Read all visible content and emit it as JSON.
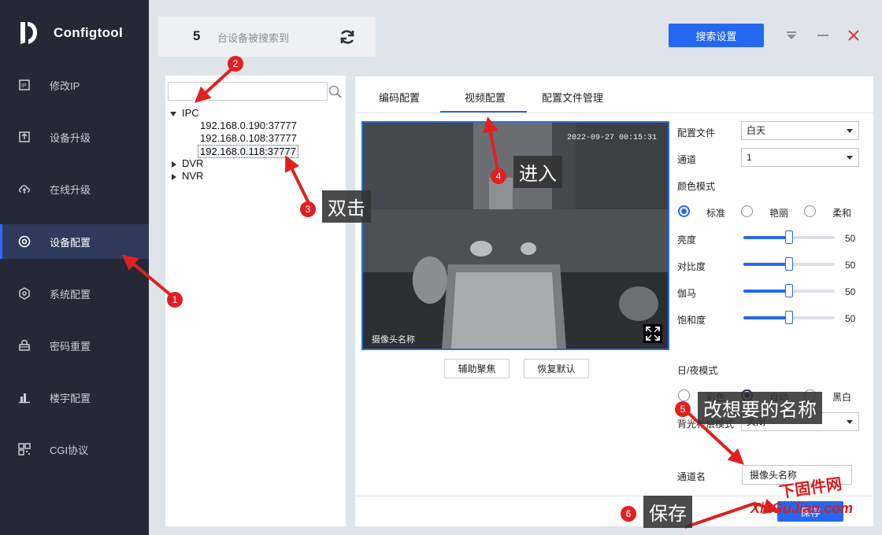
{
  "app": {
    "title": "Configtool"
  },
  "sidebar": {
    "items": [
      {
        "label": "修改IP",
        "icon": "ip-icon"
      },
      {
        "label": "设备升级",
        "icon": "upload-icon"
      },
      {
        "label": "在线升级",
        "icon": "cloud-upload-icon"
      },
      {
        "label": "设备配置",
        "icon": "target-icon",
        "active": true
      },
      {
        "label": "系统配置",
        "icon": "hexagon-gear-icon"
      },
      {
        "label": "密码重置",
        "icon": "lock-icon"
      },
      {
        "label": "楼宇配置",
        "icon": "bar-chart-icon"
      },
      {
        "label": "CGI协议",
        "icon": "qr-code-icon"
      }
    ]
  },
  "header": {
    "device_count": "5",
    "device_count_label": "台设备被搜索到",
    "search_settings_label": "搜索设置"
  },
  "tree": {
    "search_placeholder": "",
    "groups": [
      {
        "label": "IPC",
        "expanded": true,
        "children": [
          "192.168.0.190:37777",
          "192.168.0.108:37777",
          "192.168.0.118:37777"
        ]
      },
      {
        "label": "DVR",
        "expanded": false
      },
      {
        "label": "NVR",
        "expanded": false
      }
    ]
  },
  "config": {
    "tabs": [
      "编码配置",
      "视频配置",
      "配置文件管理"
    ],
    "active_tab": "视频配置",
    "video": {
      "timestamp": "2022-09-27 00:15:31",
      "camera_name": "摄像头名称"
    },
    "assist_focus_label": "辅助聚焦",
    "restore_default_label": "恢复默认",
    "profile_label": "配置文件",
    "profile_value": "白天",
    "channel_label": "通道",
    "channel_value": "1",
    "color_mode_label": "颜色模式",
    "color_modes": [
      "标准",
      "艳丽",
      "柔和"
    ],
    "color_mode_selected": "标准",
    "brightness_label": "亮度",
    "brightness_value": "50",
    "contrast_label": "对比度",
    "contrast_value": "50",
    "gamma_label": "伽马",
    "gamma_value": "50",
    "saturation_label": "饱和度",
    "saturation_value": "50",
    "daynight_label": "日/夜模式",
    "daynight_modes": [
      "彩色",
      "自动",
      "黑白"
    ],
    "daynight_selected": "自动",
    "backlight_label": "背光补偿模式",
    "backlight_value": "关闭",
    "channel_name_label": "通道名",
    "channel_name_value": "摄像头名称",
    "save_label": "保存"
  },
  "annotations": {
    "n1": "1",
    "n2": "2",
    "n3": "3",
    "n4": "4",
    "n5": "5",
    "n6": "6",
    "double_click": "双击",
    "enter": "进入",
    "rename": "改想要的名称",
    "save": "保存"
  },
  "watermark": {
    "top": "下固件网",
    "bottom": "XiaGuJian.com"
  },
  "colors": {
    "accent": "#2468f2",
    "sidebar_bg": "#242935",
    "annotation_red": "#e02020"
  }
}
